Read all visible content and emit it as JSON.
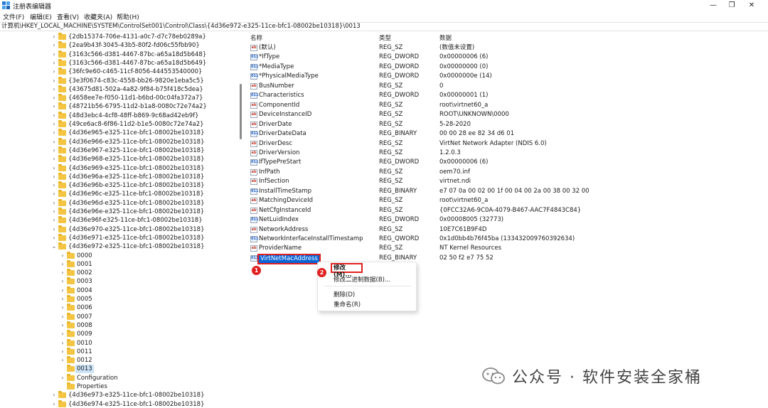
{
  "window": {
    "title": "注册表编辑器",
    "controls": [
      "—",
      "❐",
      "✕"
    ]
  },
  "menu": [
    "文件(F)",
    "编辑(E)",
    "查看(V)",
    "收藏夹(A)",
    "帮助(H)"
  ],
  "address": "计算机\\HKEY_LOCAL_MACHINE\\SYSTEM\\ControlSet001\\Control\\Class\\{4d36e972-e325-11ce-bfc1-08002be10318}\\0013",
  "tree": [
    {
      "label": "{2db15374-706e-4131-a0c7-d7c78eb0289a}",
      "indent": 0,
      "arrow": "›"
    },
    {
      "label": "{2ea9b43f-3045-43b5-80f2-fd06c55fbb90}",
      "indent": 0,
      "arrow": "›"
    },
    {
      "label": "{3163c566-d381-4467-87bc-a65a18d5b648}",
      "indent": 0,
      "arrow": "›"
    },
    {
      "label": "{3163c566-d381-4467-87bc-a65a18d5b649}",
      "indent": 0,
      "arrow": "›"
    },
    {
      "label": "{36fc9e60-c465-11cf-8056-444553540000}",
      "indent": 0,
      "arrow": "›"
    },
    {
      "label": "{3e3f0674-c83c-4558-bb26-9820e1eba5c5}",
      "indent": 0,
      "arrow": "›"
    },
    {
      "label": "{43675d81-502a-4a82-9f84-b75f418c5dea}",
      "indent": 0,
      "arrow": "›"
    },
    {
      "label": "{4658ee7e-f050-11d1-b6bd-00c04fa372a7}",
      "indent": 0,
      "arrow": "›"
    },
    {
      "label": "{48721b56-6795-11d2-b1a8-0080c72e74a2}",
      "indent": 0,
      "arrow": "›"
    },
    {
      "label": "{48d3ebc4-4cf8-48ff-b869-9c68ad42eb9f}",
      "indent": 0,
      "arrow": "›"
    },
    {
      "label": "{49ce6ac8-6f86-11d2-b1e5-0080c72e74a2}",
      "indent": 0,
      "arrow": "›"
    },
    {
      "label": "{4d36e965-e325-11ce-bfc1-08002be10318}",
      "indent": 0,
      "arrow": "›"
    },
    {
      "label": "{4d36e966-e325-11ce-bfc1-08002be10318}",
      "indent": 0,
      "arrow": "›"
    },
    {
      "label": "{4d36e967-e325-11ce-bfc1-08002be10318}",
      "indent": 0,
      "arrow": "›"
    },
    {
      "label": "{4d36e968-e325-11ce-bfc1-08002be10318}",
      "indent": 0,
      "arrow": "›"
    },
    {
      "label": "{4d36e969-e325-11ce-bfc1-08002be10318}",
      "indent": 0,
      "arrow": "›"
    },
    {
      "label": "{4d36e96a-e325-11ce-bfc1-08002be10318}",
      "indent": 0,
      "arrow": "›"
    },
    {
      "label": "{4d36e96b-e325-11ce-bfc1-08002be10318}",
      "indent": 0,
      "arrow": "›"
    },
    {
      "label": "{4d36e96c-e325-11ce-bfc1-08002be10318}",
      "indent": 0,
      "arrow": "›"
    },
    {
      "label": "{4d36e96d-e325-11ce-bfc1-08002be10318}",
      "indent": 0,
      "arrow": "›"
    },
    {
      "label": "{4d36e96e-e325-11ce-bfc1-08002be10318}",
      "indent": 0,
      "arrow": "›"
    },
    {
      "label": "{4d36e96f-e325-11ce-bfc1-08002be10318}",
      "indent": 0,
      "arrow": "›"
    },
    {
      "label": "{4d36e970-e325-11ce-bfc1-08002be10318}",
      "indent": 0,
      "arrow": "›"
    },
    {
      "label": "{4d36e971-e325-11ce-bfc1-08002be10318}",
      "indent": 0,
      "arrow": "›"
    },
    {
      "label": "{4d36e972-e325-11ce-bfc1-08002be10318}",
      "indent": 0,
      "arrow": "⌄"
    },
    {
      "label": "0000",
      "indent": 1,
      "arrow": "›"
    },
    {
      "label": "0001",
      "indent": 1,
      "arrow": "›"
    },
    {
      "label": "0002",
      "indent": 1,
      "arrow": "›"
    },
    {
      "label": "0003",
      "indent": 1,
      "arrow": "›"
    },
    {
      "label": "0004",
      "indent": 1,
      "arrow": "›"
    },
    {
      "label": "0005",
      "indent": 1,
      "arrow": "›"
    },
    {
      "label": "0006",
      "indent": 1,
      "arrow": "›"
    },
    {
      "label": "0007",
      "indent": 1,
      "arrow": "›"
    },
    {
      "label": "0008",
      "indent": 1,
      "arrow": "›"
    },
    {
      "label": "0009",
      "indent": 1,
      "arrow": "›"
    },
    {
      "label": "0010",
      "indent": 1,
      "arrow": "›"
    },
    {
      "label": "0011",
      "indent": 1,
      "arrow": "›"
    },
    {
      "label": "0012",
      "indent": 1,
      "arrow": "›"
    },
    {
      "label": "0013",
      "indent": 1,
      "arrow": "",
      "selected": true
    },
    {
      "label": "Configuration",
      "indent": 1,
      "arrow": "›"
    },
    {
      "label": "Properties",
      "indent": 1,
      "arrow": ""
    },
    {
      "label": "{4d36e973-e325-11ce-bfc1-08002be10318}",
      "indent": 0,
      "arrow": "›"
    },
    {
      "label": "{4d36e974-e325-11ce-bfc1-08002be10318}",
      "indent": 0,
      "arrow": "›"
    }
  ],
  "columns": {
    "name": "名称",
    "type": "类型",
    "data": "数据"
  },
  "values": [
    {
      "name": "(默认)",
      "type": "REG_SZ",
      "data": "(数值未设置)",
      "icon": "ab"
    },
    {
      "name": "*IfType",
      "type": "REG_DWORD",
      "data": "0x00000006 (6)",
      "icon": "bin"
    },
    {
      "name": "*MediaType",
      "type": "REG_DWORD",
      "data": "0x00000000 (0)",
      "icon": "bin"
    },
    {
      "name": "*PhysicalMediaType",
      "type": "REG_DWORD",
      "data": "0x0000000e (14)",
      "icon": "bin"
    },
    {
      "name": "BusNumber",
      "type": "REG_SZ",
      "data": "0",
      "icon": "ab"
    },
    {
      "name": "Characteristics",
      "type": "REG_DWORD",
      "data": "0x00000001 (1)",
      "icon": "bin"
    },
    {
      "name": "ComponentId",
      "type": "REG_SZ",
      "data": "root\\virtnet60_a",
      "icon": "ab"
    },
    {
      "name": "DeviceInstanceID",
      "type": "REG_SZ",
      "data": "ROOT\\UNKNOWN\\0000",
      "icon": "ab"
    },
    {
      "name": "DriverDate",
      "type": "REG_SZ",
      "data": "5-28-2020",
      "icon": "ab"
    },
    {
      "name": "DriverDateData",
      "type": "REG_BINARY",
      "data": "00 00 28 ee 82 34 d6 01",
      "icon": "bin"
    },
    {
      "name": "DriverDesc",
      "type": "REG_SZ",
      "data": "VirtNet Network Adapter (NDIS 6.0)",
      "icon": "ab"
    },
    {
      "name": "DriverVersion",
      "type": "REG_SZ",
      "data": "1.2.0.3",
      "icon": "ab"
    },
    {
      "name": "IfTypePreStart",
      "type": "REG_DWORD",
      "data": "0x00000006 (6)",
      "icon": "bin"
    },
    {
      "name": "InfPath",
      "type": "REG_SZ",
      "data": "oem70.inf",
      "icon": "ab"
    },
    {
      "name": "InfSection",
      "type": "REG_SZ",
      "data": "virtnet.ndi",
      "icon": "ab"
    },
    {
      "name": "InstallTimeStamp",
      "type": "REG_BINARY",
      "data": "e7 07 0a 00 02 00 1f 00 04 00 2a 00 38 00 32 00",
      "icon": "bin"
    },
    {
      "name": "MatchingDeviceId",
      "type": "REG_SZ",
      "data": "root\\virtnet60_a",
      "icon": "ab"
    },
    {
      "name": "NetCfgInstanceId",
      "type": "REG_SZ",
      "data": "{0FCC32A6-9C0A-4079-B467-AAC7F4843C84}",
      "icon": "ab"
    },
    {
      "name": "NetLuidIndex",
      "type": "REG_DWORD",
      "data": "0x00008005 (32773)",
      "icon": "bin"
    },
    {
      "name": "NetworkAddress",
      "type": "REG_SZ",
      "data": "10E7C61B9F4D",
      "icon": "ab"
    },
    {
      "name": "NetworkInterfaceInstallTimestamp",
      "type": "REG_QWORD",
      "data": "0x1d0bb4b76f45ba (133432009760392634)",
      "icon": "bin"
    },
    {
      "name": "ProviderName",
      "type": "REG_SZ",
      "data": "NT Kernel Resources",
      "icon": "ab"
    },
    {
      "name": "VirtNetMacAddress",
      "type": "REG_BINARY",
      "data": "02 50 f2 e7 75 52",
      "icon": "bin",
      "selected": true
    }
  ],
  "context_menu": {
    "modify": "修改(M)...",
    "modify_binary": "修改二进制数据(B)...",
    "delete": "删除(D)",
    "rename": "重命名(R)"
  },
  "badges": [
    "1",
    "2"
  ],
  "watermark": "公众号 · 软件安装全家桶",
  "colors": {
    "accent": "#0a64d6",
    "highlight": "#e02020",
    "folder": "#f4c542"
  }
}
